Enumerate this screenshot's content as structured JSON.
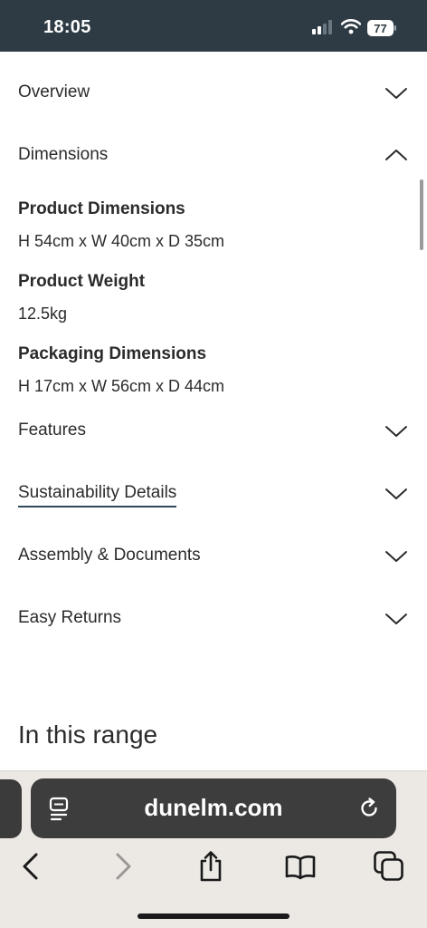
{
  "status_bar": {
    "time": "18:05",
    "battery": "77"
  },
  "accordion": {
    "overview": "Overview",
    "dimensions": "Dimensions",
    "features": "Features",
    "sustainability": "Sustainability Details",
    "assembly": "Assembly & Documents",
    "returns": "Easy Returns"
  },
  "dimensions": {
    "product_label": "Product Dimensions",
    "product_value": "H 54cm x W 40cm x D 35cm",
    "weight_label": "Product Weight",
    "weight_value": "12.5kg",
    "packaging_label": "Packaging Dimensions",
    "packaging_value": "H 17cm x W 56cm x D 44cm"
  },
  "range_title": "In this range",
  "browser": {
    "url": "dunelm.com"
  },
  "icons": [
    "cellular-signal-icon",
    "wifi-icon",
    "battery-icon",
    "chevron-down-icon",
    "chevron-up-icon",
    "reader-icon",
    "reload-icon",
    "back-icon",
    "forward-icon",
    "share-icon",
    "bookmarks-icon",
    "tabs-icon"
  ]
}
